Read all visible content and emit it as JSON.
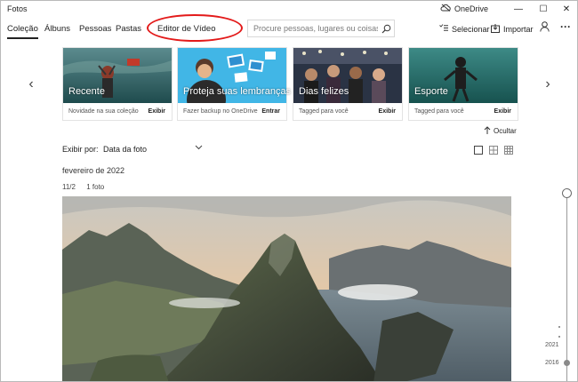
{
  "titlebar": {
    "app_title": "Fotos",
    "onedrive_label": "OneDrive",
    "minimize": "—",
    "maximize": "☐",
    "close": "✕"
  },
  "nav": {
    "tabs": [
      {
        "label": "Coleção",
        "active": true
      },
      {
        "label": "Álbuns",
        "active": false
      },
      {
        "label": "Pessoas",
        "active": false
      },
      {
        "label": "Pastas",
        "active": false
      },
      {
        "label": "Editor de Vídeo",
        "active": false
      }
    ],
    "search_placeholder": "Procure pessoas, lugares ou coisas...",
    "select_label": "Selecionar",
    "import_label": "Importar",
    "more": "···"
  },
  "carousel": {
    "prev": "‹",
    "next": "›",
    "cards": [
      {
        "title": "Recente",
        "subtitle": "Novidade na sua coleção",
        "action": "Exibir"
      },
      {
        "title": "Proteja suas lembranças",
        "subtitle": "Fazer backup no OneDrive",
        "action": "Entrar"
      },
      {
        "title": "Dias felizes",
        "subtitle": "Tagged para você",
        "action": "Exibir"
      },
      {
        "title": "Esporte",
        "subtitle": "Tagged para você",
        "action": "Exibir"
      }
    ],
    "hide_label": "Ocultar"
  },
  "viewby": {
    "label": "Exibir por:",
    "value": "Data da foto"
  },
  "collection": {
    "month": "fevereiro de 2022",
    "day": "11/2",
    "count": "1 foto"
  },
  "timeline": {
    "years": [
      "2021",
      "2016"
    ]
  },
  "colors": {
    "highlight": "#e31a1a",
    "text": "#1f1f1f"
  }
}
